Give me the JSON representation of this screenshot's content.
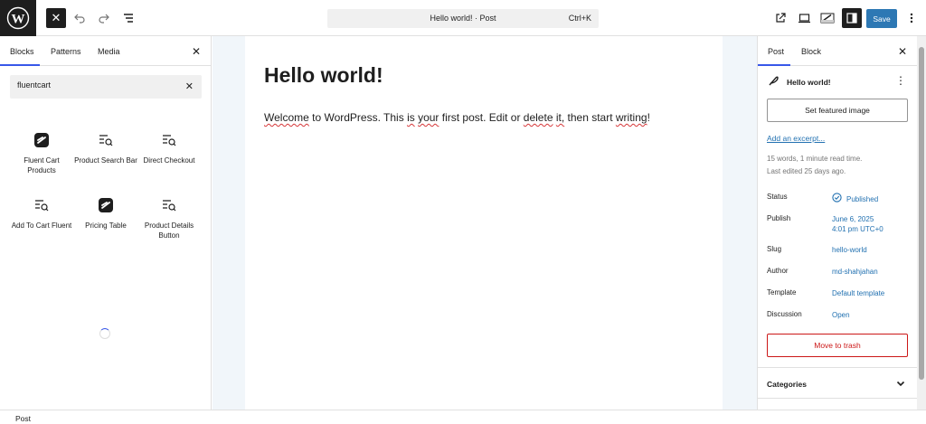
{
  "header": {
    "command_title": "Hello world! · Post",
    "command_shortcut": "Ctrl+K",
    "save_label": "Save"
  },
  "inserter": {
    "tabs": [
      "Blocks",
      "Patterns",
      "Media"
    ],
    "search_value": "fluentcart",
    "blocks": [
      {
        "label": "Fluent Cart Products",
        "icon": "fluent-cart-logo-icon"
      },
      {
        "label": "Product Search Bar",
        "icon": "list-search-icon"
      },
      {
        "label": "Direct Checkout",
        "icon": "list-search-icon"
      },
      {
        "label": "Add To Cart Fluent",
        "icon": "list-search-icon"
      },
      {
        "label": "Pricing Table",
        "icon": "fluent-cart-logo-icon"
      },
      {
        "label": "Product Details Button",
        "icon": "list-search-icon"
      }
    ]
  },
  "editor": {
    "title": "Hello world!",
    "paragraph_parts": [
      "Welcome",
      " to WordPress. This ",
      "is",
      " ",
      "your",
      " first post. Edit or ",
      "delete",
      " ",
      "it,",
      " then start ",
      "writing",
      "!"
    ]
  },
  "settings": {
    "tabs": [
      "Post",
      "Block"
    ],
    "post_title": "Hello world!",
    "featured_image_label": "Set featured image",
    "excerpt_link": "Add an excerpt...",
    "word_count": "15 words, 1 minute read time.",
    "last_edited": "Last edited 25 days ago.",
    "rows": {
      "status_label": "Status",
      "status_value": "Published",
      "publish_label": "Publish",
      "publish_date": "June 6, 2025",
      "publish_time": "4:01 pm UTC+0",
      "slug_label": "Slug",
      "slug_value": "hello-world",
      "author_label": "Author",
      "author_value": "md-shahjahan",
      "template_label": "Template",
      "template_value": "Default template",
      "discussion_label": "Discussion",
      "discussion_value": "Open"
    },
    "trash_label": "Move to trash",
    "categories_label": "Categories"
  },
  "statusbar": {
    "breadcrumb": "Post"
  },
  "colors": {
    "accent": "#3858e9",
    "link": "#2271b1",
    "danger": "#cc1818",
    "dark": "#1e1e1e"
  }
}
